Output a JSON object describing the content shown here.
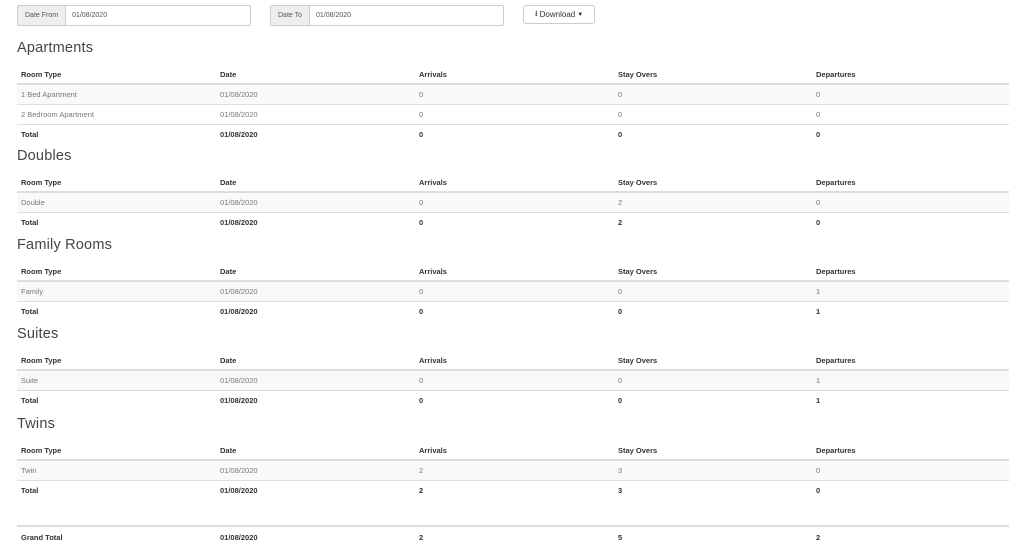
{
  "filters": {
    "date_from_label": "Date From",
    "date_from_value": "01/08/2020",
    "date_to_label": "Date To",
    "date_to_value": "01/08/2020",
    "download_label": "Download"
  },
  "columns": [
    "Room Type",
    "Date",
    "Arrivals",
    "Stay Overs",
    "Departures"
  ],
  "sections": [
    {
      "title": "Apartments",
      "rows": [
        [
          "1 Bed Apartment",
          "01/08/2020",
          "0",
          "0",
          "0"
        ],
        [
          "2 Bedroom Apartment",
          "01/08/2020",
          "0",
          "0",
          "0"
        ]
      ],
      "total": [
        "Total",
        "01/08/2020",
        "0",
        "0",
        "0"
      ]
    },
    {
      "title": "Doubles",
      "rows": [
        [
          "Double",
          "01/08/2020",
          "0",
          "2",
          "0"
        ]
      ],
      "total": [
        "Total",
        "01/08/2020",
        "0",
        "2",
        "0"
      ]
    },
    {
      "title": "Family Rooms",
      "rows": [
        [
          "Family",
          "01/08/2020",
          "0",
          "0",
          "1"
        ]
      ],
      "total": [
        "Total",
        "01/08/2020",
        "0",
        "0",
        "1"
      ]
    },
    {
      "title": "Suites",
      "rows": [
        [
          "Suite",
          "01/08/2020",
          "0",
          "0",
          "1"
        ]
      ],
      "total": [
        "Total",
        "01/08/2020",
        "0",
        "0",
        "1"
      ]
    },
    {
      "title": "Twins",
      "rows": [
        [
          "Twin",
          "01/08/2020",
          "2",
          "3",
          "0"
        ]
      ],
      "total": [
        "Total",
        "01/08/2020",
        "2",
        "3",
        "0"
      ]
    }
  ],
  "grand_total": [
    "Grand Total",
    "01/08/2020",
    "2",
    "5",
    "2"
  ]
}
